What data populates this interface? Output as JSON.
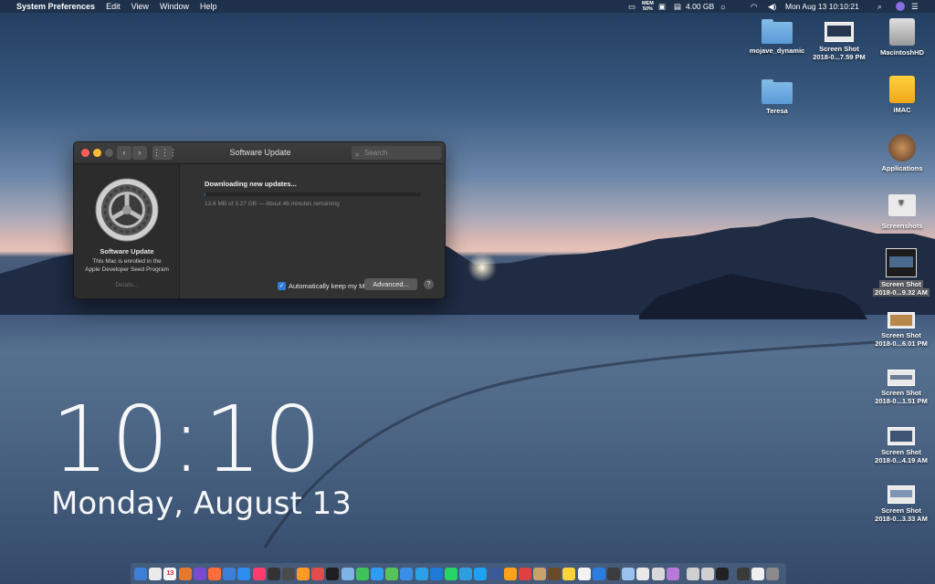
{
  "menubar": {
    "app": "System Preferences",
    "menus": [
      "Edit",
      "View",
      "Window",
      "Help"
    ],
    "status": {
      "mem_top": "MEM",
      "mem_bottom": "50%",
      "storage": "4.00 GB",
      "datetime": "Mon Aug 13  10:10:21"
    }
  },
  "window": {
    "title": "Software Update",
    "search_placeholder": "Search",
    "sidebar": {
      "title": "Software Update",
      "description": "This Mac is enrolled in the Apple Developer Seed Program",
      "details_link": "Details..."
    },
    "status_title": "Downloading new updates...",
    "progress_text": "13.6 MB of 3.27 GB — About 46 minutes remaining",
    "progress_fraction": 0.004,
    "auto_update_label": "Automatically keep my Mac up to date",
    "auto_update_checked": true,
    "advanced_button": "Advanced...",
    "help_button": "?"
  },
  "clock": {
    "time": "10:10",
    "date": "Monday, August 13"
  },
  "desktop_items": [
    {
      "name": "mojave_dynamic",
      "kind": "folder"
    },
    {
      "name": "Screen Shot",
      "sub": "2018-0...7.59 PM",
      "kind": "screenshot"
    },
    {
      "name": "MacintoshHD",
      "kind": "drive"
    },
    {
      "name": "Teresa",
      "kind": "folder"
    },
    {
      "name": "iMAC",
      "kind": "drive-yellow"
    },
    {
      "name": "Applications",
      "kind": "apps"
    },
    {
      "name": "Screenshots",
      "kind": "folder-white"
    },
    {
      "name": "Screen Shot",
      "sub": "2018-0...9.32 AM",
      "kind": "screenshot",
      "selected": true
    },
    {
      "name": "Screen Shot",
      "sub": "2018-0...6.01 PM",
      "kind": "screenshot"
    },
    {
      "name": "Screen Shot",
      "sub": "2018-0...1.51 PM",
      "kind": "screenshot"
    },
    {
      "name": "Screen Shot",
      "sub": "2018-0...4.19 AM",
      "kind": "screenshot"
    },
    {
      "name": "Screen Shot",
      "sub": "2018-0...3.33 AM",
      "kind": "screenshot"
    }
  ],
  "dock": {
    "calendar_day": "13",
    "colors": [
      "#3b7fd6",
      "#eaeaea",
      "#f4f4f4",
      "#e57a2c",
      "#7a4bd1",
      "#ff6e3a",
      "#3b7fd6",
      "#2d8cf0",
      "#fc3c6b",
      "#333333",
      "#4b4b4b",
      "#ff9a26",
      "#e14b4b",
      "#1e1e1e",
      "#7fb2e5",
      "#3ec35a",
      "#2f9cf0",
      "#56c25c",
      "#3a8ee6",
      "#2aa1e6",
      "#1e7ad6",
      "#25d366",
      "#2c9fe0",
      "#1da1f2",
      "#3b5998",
      "#ffa21a",
      "#e04040",
      "#c9a26b",
      "#6b4a2a",
      "#ffd43a",
      "#f2f2f2",
      "#2a7de1",
      "#3c3c3c",
      "#9bc3ef",
      "#e8e8e8",
      "#d8d8d8",
      "#b878d8",
      "#cfcfcf",
      "#d0d0d0",
      "#222222",
      "#3a3a3a",
      "#f0f0f0",
      "#8a8a8a"
    ]
  }
}
